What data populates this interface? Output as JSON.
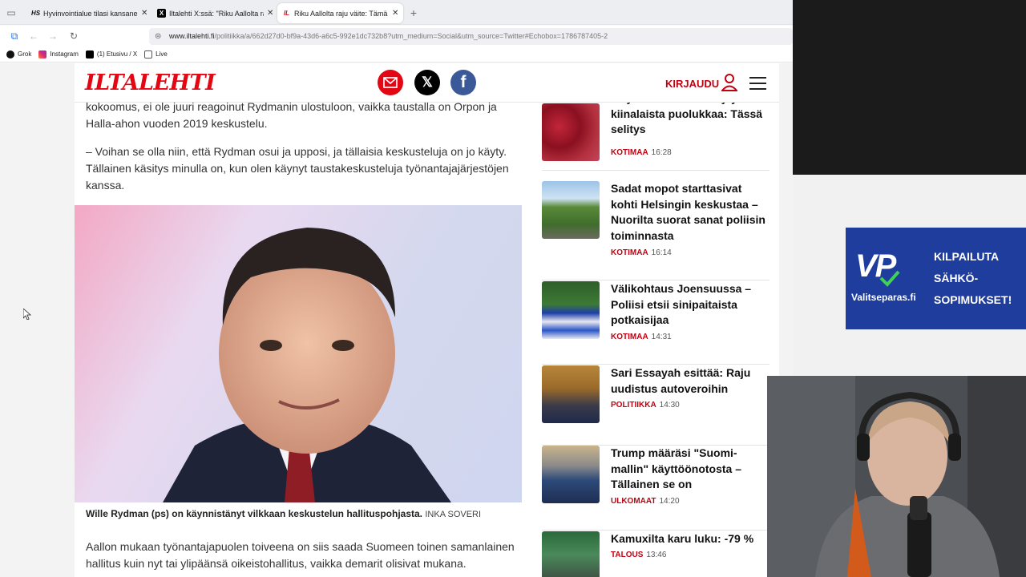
{
  "tabs": [
    {
      "title": "Hyvinvointialue tilasi kansanedustajalta",
      "favicon": "HS",
      "active": false
    },
    {
      "title": "Iltalehti X:ssä: \"Riku Aallolta raju\"",
      "favicon": "X",
      "active": false
    },
    {
      "title": "Riku Aallolta raju väite: Tämä on",
      "favicon": "IL",
      "active": true
    }
  ],
  "new_tab": "+",
  "address": {
    "host": "www.iltalehti.fi",
    "path": "/politiikka/a/662d27d0-bf9a-43d6-a6c5-992e1dc732b8?utm_medium=Social&utm_source=Twitter#Echobox=1786787405-2"
  },
  "bookmarks": [
    {
      "label": "Grok",
      "icon": "grok-icon"
    },
    {
      "label": "Instagram",
      "icon": "instagram-icon"
    },
    {
      "label": "(1) Etusivu / X",
      "icon": "x-icon"
    },
    {
      "label": "Live",
      "icon": "folder-icon"
    }
  ],
  "site": {
    "logo": "ILTALEHTI",
    "login": "KIRJAUDU",
    "brand_color": "#e30613"
  },
  "article": {
    "paragraphs": [
      "kokoomus, ei ole juuri reagoinut Rydmanin ulostuloon, vaikka taustalla on Orpon ja Halla-ahon vuoden 2019 keskustelu.",
      "– Voihan se olla niin, että Rydman osui ja upposi, ja tällaisia keskusteluja on jo käyty. Tällainen käsitys minulla on, kun olen käynyt taustakeskusteluja työnantajajärjestöjen kanssa.",
      "Aallon mukaan työnantajapuolen toiveena on siis saada Suomeen toinen samanlainen hallitus kuin nyt tai ylipäänsä oikeistohallitus, vaikka demarit olisivat mukana."
    ],
    "caption": "Wille Rydman (ps) on käynnistänyt vilkkaan keskustelun hallituspohjasta.",
    "credit": "INKA SOVERI"
  },
  "sidebar": [
    {
      "title": "S-ryhmän hilloista löytyi kiinalaista puolukkaa: Tässä selitys",
      "category": "KOTIMAA",
      "time": "16:28"
    },
    {
      "title": "Sadat mopot starttasivat kohti Helsingin keskustaa – Nuorilta suorat sanat poliisin toiminnasta",
      "category": "KOTIMAA",
      "time": "16:14"
    },
    {
      "title": "Välikohtaus Joensuussa – Poliisi etsii sinipaitaista potkaisijaa",
      "category": "KOTIMAA",
      "time": "14:31"
    },
    {
      "title": "Sari Essayah esittää: Raju uudistus autoveroihin",
      "category": "POLITIIKKA",
      "time": "14:30"
    },
    {
      "title": "Trump määräsi \"Suomi-mallin\" käyttöönotosta – Tällainen se on",
      "category": "ULKOMAAT",
      "time": "14:20"
    },
    {
      "title": "Kamuxilta karu luku: -79 %",
      "category": "TALOUS",
      "time": "13:46"
    }
  ],
  "ad": {
    "logo": "VP",
    "site": "Valitseparas.fi",
    "lines": [
      "KILPAILUTA",
      "SÄHKÖ-",
      "SOPIMUKSET!"
    ]
  }
}
